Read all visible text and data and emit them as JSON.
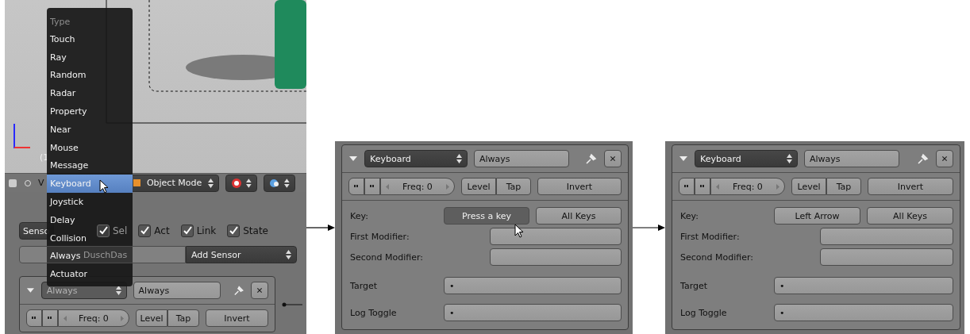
{
  "viewport": {
    "label": "(1"
  },
  "header": {
    "view_label": "V",
    "mode_select": "Object Mode"
  },
  "type_menu": {
    "title": "Type",
    "items": [
      {
        "label": "Touch",
        "selected": false
      },
      {
        "label": "Ray",
        "selected": false
      },
      {
        "label": "Random",
        "selected": false
      },
      {
        "label": "Radar",
        "selected": false
      },
      {
        "label": "Property",
        "selected": false
      },
      {
        "label": "Near",
        "selected": false
      },
      {
        "label": "Mouse",
        "selected": false
      },
      {
        "label": "Message",
        "selected": false
      },
      {
        "label": "Keyboard",
        "selected": true
      },
      {
        "label": "Joystick",
        "selected": false
      },
      {
        "label": "Delay",
        "selected": false
      },
      {
        "label": "Collision",
        "selected": false
      },
      {
        "label": "Always",
        "selected": false
      },
      {
        "label": "Actuator",
        "selected": false
      }
    ]
  },
  "logic_editor": {
    "sensor_select": "Senso",
    "filters": [
      {
        "label": "Sel",
        "checked": true,
        "disabled": true
      },
      {
        "label": "Act",
        "checked": true,
        "disabled": false
      },
      {
        "label": "Link",
        "checked": true,
        "disabled": false
      },
      {
        "label": "State",
        "checked": true,
        "disabled": false
      }
    ],
    "object_name": "DuschDas",
    "add_sensor": "Add Sensor",
    "brick": {
      "type": "Always",
      "name": "Always",
      "expanded": true,
      "freq": "Freq: 0",
      "level": "Level",
      "tap": "Tap",
      "invert": "Invert"
    }
  },
  "bricks": [
    {
      "type": "Keyboard",
      "name": "Always",
      "expanded": true,
      "freq": "Freq: 0",
      "level": "Level",
      "tap": "Tap",
      "invert": "Invert",
      "keys": {
        "key_label": "Key:",
        "key_button": {
          "label": "Press a key",
          "active": true
        },
        "all_keys": "All Keys",
        "first_modifier": "First Modifier:",
        "second_modifier": "Second Modifier:",
        "target_label": "Target",
        "target_value": "•",
        "log_toggle_label": "Log Toggle",
        "log_toggle_value": "•"
      }
    },
    {
      "type": "Keyboard",
      "name": "Always",
      "expanded": true,
      "freq": "Freq: 0",
      "level": "Level",
      "tap": "Tap",
      "invert": "Invert",
      "keys": {
        "key_label": "Key:",
        "key_button": {
          "label": "Left Arrow",
          "active": false
        },
        "all_keys": "All Keys",
        "first_modifier": "First Modifier:",
        "second_modifier": "Second Modifier:",
        "target_label": "Target",
        "target_value": "•",
        "log_toggle_label": "Log Toggle",
        "log_toggle_value": "•"
      }
    }
  ]
}
